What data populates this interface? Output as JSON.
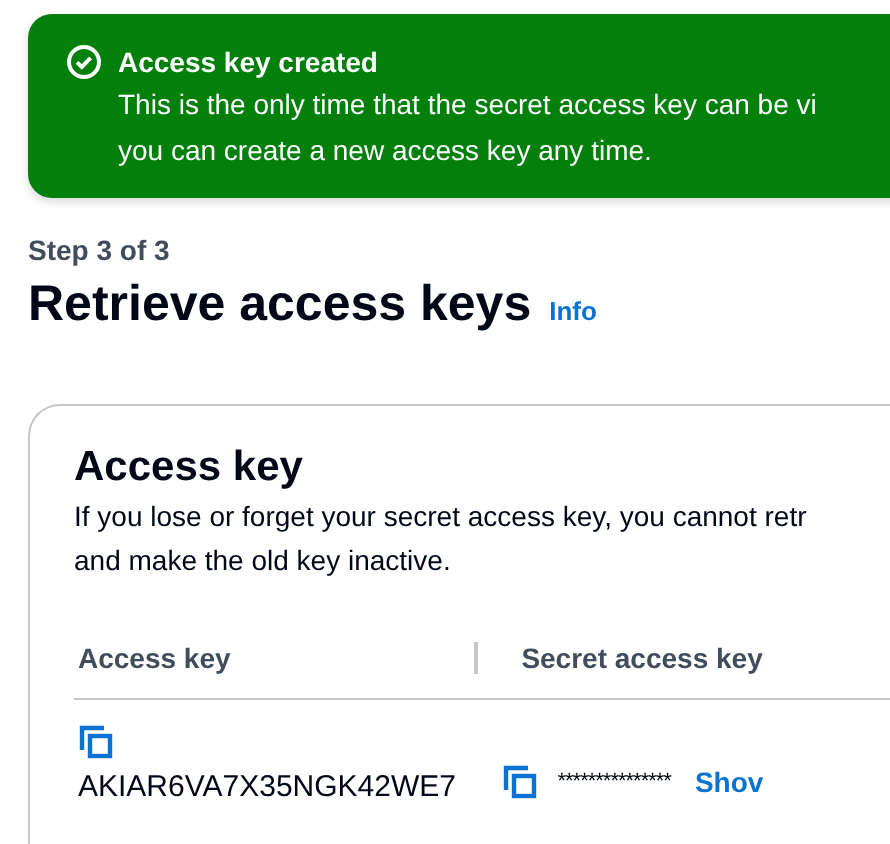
{
  "flash": {
    "title": "Access key created",
    "lines": [
      "This is the only time that the secret access key can be vi",
      "you can create a new access key any time."
    ]
  },
  "step": "Step 3 of 3",
  "heading": {
    "title": "Retrieve access keys",
    "info": "Info"
  },
  "card": {
    "title": "Access key",
    "description": [
      "If you lose or forget your secret access key, you cannot retr",
      "and make the old key inactive."
    ],
    "columns": [
      "Access key",
      "Secret access key"
    ],
    "row": {
      "access_key": "AKIAR6VA7X35NGK42WE7",
      "secret": "***************",
      "show": "Shov"
    }
  }
}
